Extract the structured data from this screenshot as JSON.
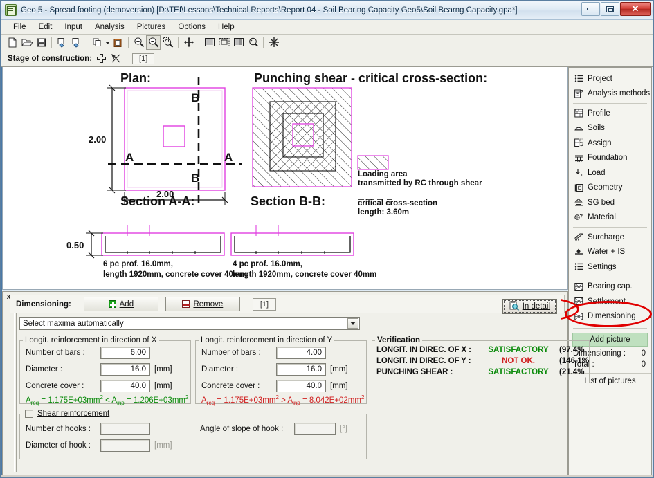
{
  "window": {
    "title": "Geo 5 - Spread footing (demoversion) [D:\\TEI\\Lessons\\Technical Reports\\Report 04 - Soil Bearing Capacity Geo5\\Soil Bearng Capacity.gpa*]",
    "minimize_label": "–",
    "maximize_label": "□",
    "close_label": "✕",
    "app_icon": "geo5-app-icon"
  },
  "menu": {
    "items": [
      {
        "label": "File",
        "accel": "F"
      },
      {
        "label": "Edit",
        "accel": "E"
      },
      {
        "label": "Input",
        "accel": "I"
      },
      {
        "label": "Analysis",
        "accel": "A"
      },
      {
        "label": "Pictures",
        "accel": "P"
      },
      {
        "label": "Options",
        "accel": "O"
      },
      {
        "label": "Help",
        "accel": "H"
      }
    ]
  },
  "toolbar": {
    "buttons": [
      "new-file-icon",
      "open-file-icon",
      "save-file-icon",
      "print-preview-icon",
      "print-icon",
      "copy-icon",
      "copy-dropdown-icon",
      "paste-icon",
      "zoom-in-icon",
      "zoom-out-icon",
      "zoom-window-icon",
      "pan-icon",
      "zoom-all-icon",
      "zoom-extents-icon",
      "zoom-selection-icon",
      "zoom-previous-icon",
      "refresh-icon"
    ]
  },
  "stage": {
    "label": "Stage of construction:",
    "add_icon": "add-stage-icon",
    "remove_icon": "remove-stage-icon",
    "tab_label": "[1]"
  },
  "drawing": {
    "plan_title": "Plan:",
    "plan_dim_vertical": "2.00",
    "plan_dim_horizontal": "2.00",
    "section_marker_a": "A",
    "section_marker_b": "B",
    "punch_title": "Punching shear - critical cross-section:",
    "legend_line1": "Loading area",
    "legend_line2": "transmitted by RC through shear",
    "legend_line3": "critical cross-section",
    "legend_line4": "length: 3.60m",
    "section_a_title": "Section A-A:",
    "section_b_title": "Section B-B:",
    "section_height_dim": "0.50",
    "section_a_note1": "6 pc prof. 16.0mm,",
    "section_a_note2": "length 1920mm, concrete cover 40mm",
    "section_b_note1": "4 pc prof. 16.0mm,",
    "section_b_note2": "length 1920mm, concrete cover 40mm"
  },
  "sidebar": {
    "group1": [
      {
        "label": "Project",
        "icon": "project-icon"
      },
      {
        "label": "Analysis methods",
        "icon": "analysis-methods-icon"
      }
    ],
    "group2": [
      {
        "label": "Profile",
        "icon": "profile-icon"
      },
      {
        "label": "Soils",
        "icon": "soils-icon"
      },
      {
        "label": "Assign",
        "icon": "assign-icon"
      },
      {
        "label": "Foundation",
        "icon": "foundation-icon"
      },
      {
        "label": "Load",
        "icon": "load-icon"
      },
      {
        "label": "Geometry",
        "icon": "geometry-icon"
      },
      {
        "label": "SG bed",
        "icon": "sg-bed-icon"
      },
      {
        "label": "Material",
        "icon": "material-icon"
      }
    ],
    "group3": [
      {
        "label": "Surcharge",
        "icon": "surcharge-icon"
      },
      {
        "label": "Water + IS",
        "icon": "water-icon"
      },
      {
        "label": "Settings",
        "icon": "settings-icon"
      }
    ],
    "group4": [
      {
        "label": "Bearing cap.",
        "icon": "bearing-capacity-icon"
      },
      {
        "label": "Settlement",
        "icon": "settlement-icon"
      },
      {
        "label": "Dimensioning",
        "icon": "dimensioning-icon"
      }
    ],
    "add_picture": "Add picture",
    "counters": [
      {
        "label": "Dimensioning :",
        "value": "0"
      },
      {
        "label": "Total :",
        "value": "0"
      }
    ],
    "list_of_pictures": "List of pictures",
    "highlight_color": "#e00000"
  },
  "dock": {
    "close_label": "x",
    "title": "Dimensioning:",
    "add_label": "Add",
    "remove_label": "Remove",
    "tab_label": "[1]",
    "in_detail_label": "In detail",
    "in_detail_icon": "in-detail-icon",
    "combo_value": "Select maxima automatically",
    "combo_arrow_icon": "chevron-down-icon"
  },
  "reinf_x": {
    "legend": "Longit. reinforcement in direction of  X",
    "rows": [
      {
        "label": "Number of bars :",
        "value": "6.00",
        "unit": ""
      },
      {
        "label": "Diameter :",
        "value": "16.0",
        "unit": "[mm]"
      },
      {
        "label": "Concrete cover :",
        "value": "40.0",
        "unit": "[mm]"
      }
    ],
    "formula": {
      "a_req_name": "A",
      "a_req_sub": "req",
      "a_req_val": "1.175E+03mm",
      "op": "<",
      "a_inp_name": "A",
      "a_inp_sub": "inp",
      "a_inp_val": "1.206E+03mm",
      "exp": "2",
      "status": "ok"
    }
  },
  "reinf_y": {
    "legend": "Longit. reinforcement in direction of Y",
    "rows": [
      {
        "label": "Number of bars :",
        "value": "4.00",
        "unit": ""
      },
      {
        "label": "Diameter :",
        "value": "16.0",
        "unit": "[mm]"
      },
      {
        "label": "Concrete cover :",
        "value": "40.0",
        "unit": "[mm]"
      }
    ],
    "formula": {
      "a_req_name": "A",
      "a_req_sub": "req",
      "a_req_val": "1.175E+03mm",
      "op": ">",
      "a_inp_name": "A",
      "a_inp_sub": "inp",
      "a_inp_val": "8.042E+02mm",
      "exp": "2",
      "status": "bad"
    }
  },
  "verification": {
    "legend": "Verification",
    "rows": [
      {
        "name": "LONGIT. IN DIREC. OF X :",
        "result": "SATISFACTORY",
        "pct": "(97.4%",
        "status": "ok"
      },
      {
        "name": "LONGIT. IN DIREC. OF Y :",
        "result": "NOT OK.",
        "pct": "(146.1%",
        "status": "bad"
      },
      {
        "name": "PUNCHING SHEAR :",
        "result": "SATISFACTORY",
        "pct": "(21.4%",
        "status": "ok"
      }
    ],
    "ok_color": "#0a8a0a",
    "bad_color": "#d02020"
  },
  "shear": {
    "legend": "Shear reinforcement",
    "checked": false,
    "rows": [
      {
        "label": "Number of hooks :",
        "value": "",
        "unit": ""
      },
      {
        "label": "Diameter of hook :",
        "value": "",
        "unit": "[mm]"
      }
    ],
    "angle_label": "Angle of slope of hook :",
    "angle_value": "",
    "angle_unit": "[°]"
  }
}
